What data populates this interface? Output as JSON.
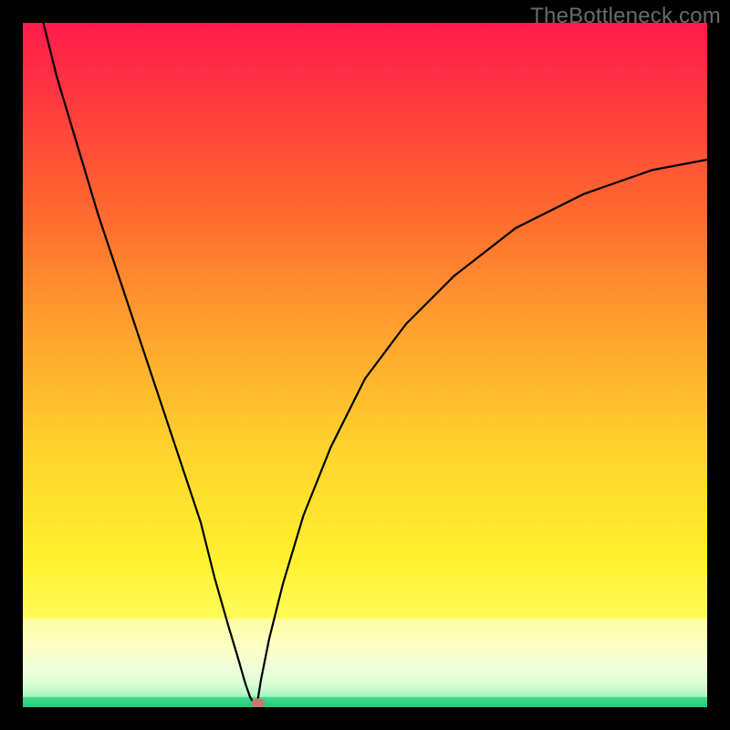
{
  "watermark": "TheBottleneck.com",
  "chart_data": {
    "type": "line",
    "title": "",
    "xlabel": "",
    "ylabel": "",
    "xlim": [
      0,
      100
    ],
    "ylim": [
      0,
      100
    ],
    "legend": false,
    "grid": false,
    "background": "rainbow-vertical-gradient (red top → green bottom)",
    "series": [
      {
        "name": "bottleneck-curve",
        "color": "#000000",
        "x": [
          3,
          5,
          8,
          11,
          14,
          17,
          20,
          23,
          26,
          28,
          30,
          31.5,
          32.5,
          33.2,
          33.8,
          34.2,
          34.4,
          34.8,
          36,
          38,
          41,
          45,
          50,
          56,
          63,
          72,
          82,
          92,
          100
        ],
        "y": [
          100,
          92,
          82,
          72,
          63,
          54,
          45,
          36,
          27,
          19,
          12,
          7,
          3.5,
          1.5,
          0.5,
          0.5,
          1.5,
          4,
          10,
          18,
          28,
          38,
          48,
          56,
          63,
          70,
          75,
          78.5,
          80
        ]
      }
    ],
    "marker": {
      "name": "sweet-spot",
      "shape": "ellipse",
      "x": 34.4,
      "y": 0.6,
      "rx": 1.0,
      "ry": 0.7,
      "color": "#c97a6a"
    },
    "green_band_top_fraction": 0.985,
    "light_band_top_fraction": 0.87
  }
}
